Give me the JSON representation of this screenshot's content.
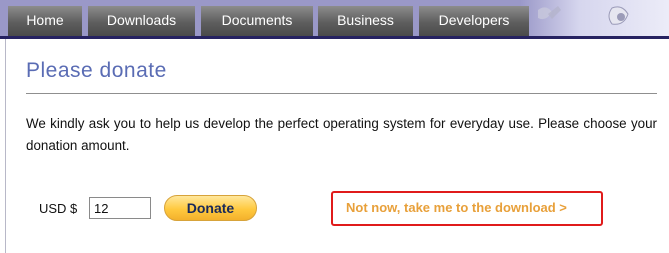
{
  "nav": {
    "tabs": [
      {
        "label": "Home"
      },
      {
        "label": "Downloads"
      },
      {
        "label": "Documents"
      },
      {
        "label": "Business"
      },
      {
        "label": "Developers"
      }
    ]
  },
  "page": {
    "title": "Please donate",
    "intro": "We kindly ask you to help us develop the perfect operating system for everyday use. Please choose your donation amount."
  },
  "donation": {
    "currency_label": "USD $",
    "amount_value": "12",
    "donate_label": "Donate",
    "skip_label": "Not now, take me to the download >"
  },
  "colors": {
    "nav_band": "#9a98c8",
    "title": "#5a6cb4",
    "donate_button": "#ffc93f",
    "skip_link": "#e8a03a",
    "highlight_box": "#e01b1b"
  }
}
